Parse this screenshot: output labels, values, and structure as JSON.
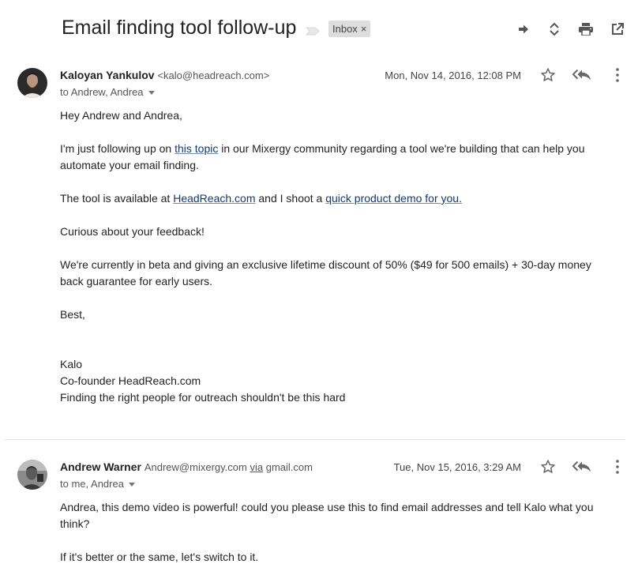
{
  "thread": {
    "subject": "Email finding tool follow-up",
    "label": "Inbox",
    "label_close": "×"
  },
  "icons": {
    "importance": "importance-marker-icon",
    "move": "arrow-right-icon",
    "expand": "expand-collapse-icon",
    "print": "print-icon",
    "popout": "open-in-new-window-icon",
    "star": "star-icon",
    "reply_all": "reply-all-icon",
    "more": "more-vertical-icon"
  },
  "messages": [
    {
      "sender_name": "Kaloyan Yankulov",
      "sender_email": "<kalo@headreach.com>",
      "to": "to Andrew, Andrea",
      "date": "Mon, Nov 14, 2016, 12:08 PM",
      "body": {
        "greeting": "Hey Andrew and Andrea,",
        "p1_before": "I'm just following up on ",
        "p1_link": "this topic",
        "p1_after": " in our Mixergy community regarding a tool we're building that can help you automate your email finding.",
        "p2_before": "The tool is available at ",
        "p2_link1": "HeadReach.com",
        "p2_mid": " and I shoot a ",
        "p2_link2": "quick product demo for you.",
        "p3": "Curious about your feedback!",
        "p4": "We're currently in beta and giving an exclusive lifetime discount of 50% ($49 for 500 emails) + 30-day money back guarantee for early users.",
        "signoff": "Best,",
        "sig_name": "Kalo",
        "sig_title": "Co-founder HeadReach.com",
        "sig_tagline": "Finding the right people for outreach shouldn't be this hard"
      }
    },
    {
      "sender_name": "Andrew Warner",
      "sender_email": "Andrew@mixergy.com",
      "via_label": "via",
      "via_domain": "gmail.com",
      "to": "to me, Andrea",
      "date": "Tue, Nov 15, 2016, 3:29 AM",
      "body": {
        "p1": "Andrea, this demo video is powerful! could you please use this to find email addresses and tell Kalo what you think?",
        "p2": "If it's better or the same, let's switch to it."
      }
    }
  ]
}
